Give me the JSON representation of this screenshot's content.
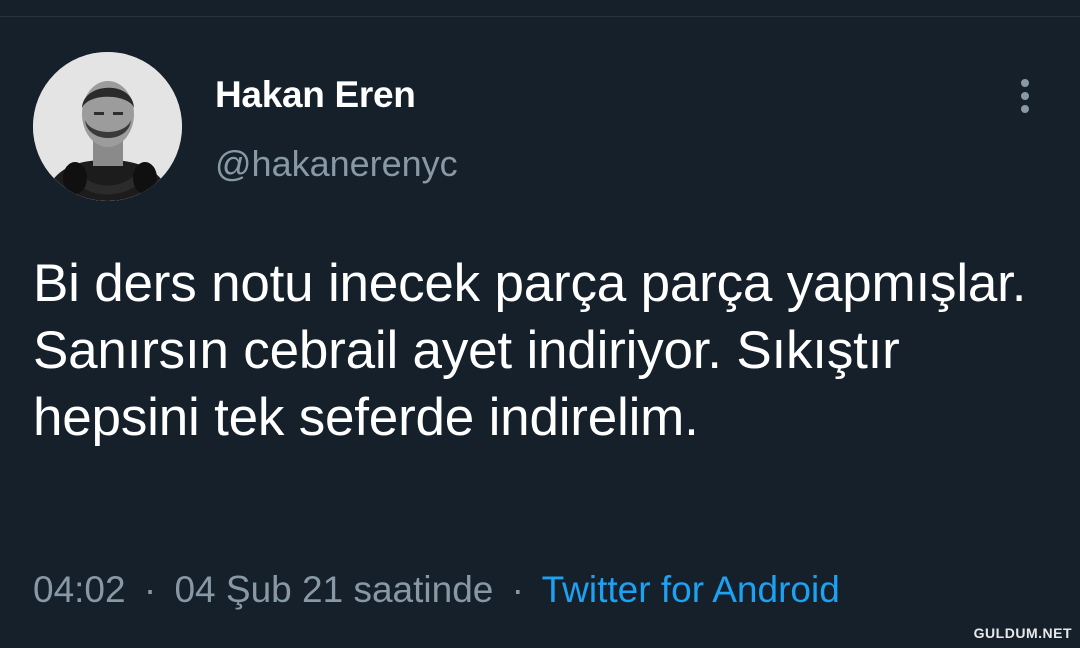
{
  "tweet": {
    "display_name": "Hakan Eren",
    "handle": "@hakanerenyc",
    "text": "Bi ders notu inecek parça parça yapmışlar. Sanırsın cebrail ayet indiriyor. Sıkıştır hepsini tek seferde indirelim.",
    "time": "04:02",
    "separator": "·",
    "date": "04 Şub 21 saatinde",
    "source": "Twitter for Android"
  },
  "icons": {
    "more": "more-vertical-icon",
    "avatar": "profile-photo"
  },
  "watermark": "GULDUM.NET",
  "colors": {
    "background": "#15202b",
    "primary_text": "#ffffff",
    "secondary_text": "#8899a6",
    "link": "#1da1f2"
  }
}
